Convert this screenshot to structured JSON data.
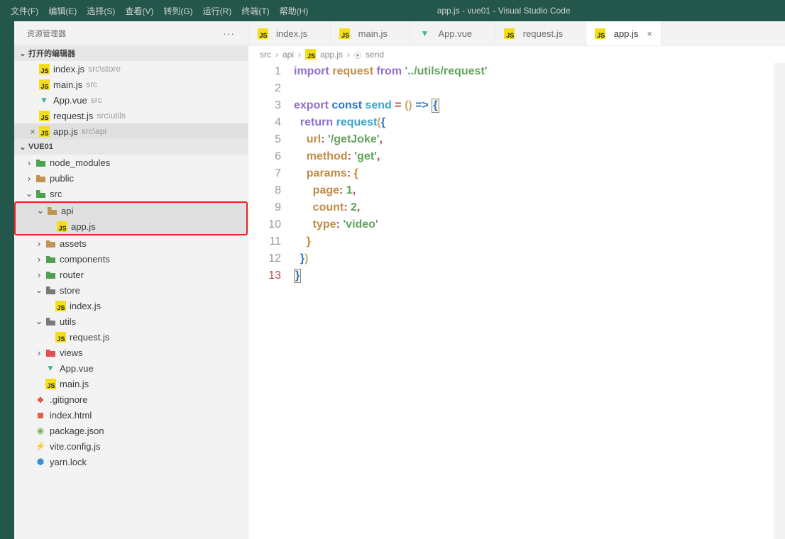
{
  "window_title": "app.js - vue01 - Visual Studio Code",
  "menu": [
    "文件(F)",
    "编辑(E)",
    "选择(S)",
    "查看(V)",
    "转到(G)",
    "运行(R)",
    "终端(T)",
    "帮助(H)"
  ],
  "sidebar": {
    "title": "资源管理器",
    "open_editors_label": "打开的编辑器",
    "project_label": "VUE01",
    "open_editors": [
      {
        "name": "index.js",
        "path": "src\\store",
        "icon": "js"
      },
      {
        "name": "main.js",
        "path": "src",
        "icon": "js"
      },
      {
        "name": "App.vue",
        "path": "src",
        "icon": "vue"
      },
      {
        "name": "request.js",
        "path": "src\\utils",
        "icon": "js"
      },
      {
        "name": "app.js",
        "path": "src\\api",
        "icon": "js",
        "active": true
      }
    ],
    "tree": [
      {
        "level": 0,
        "kind": "folder-closed",
        "color": "green",
        "name": "node_modules"
      },
      {
        "level": 0,
        "kind": "folder-closed",
        "color": "tan",
        "name": "public"
      },
      {
        "level": 0,
        "kind": "folder-open",
        "color": "green",
        "name": "src"
      },
      {
        "level": 1,
        "kind": "folder-open",
        "color": "tan",
        "name": "api",
        "red": true,
        "active": true
      },
      {
        "level": 2,
        "kind": "file",
        "icon": "js",
        "name": "app.js",
        "red": true,
        "active": true
      },
      {
        "level": 1,
        "kind": "folder-closed",
        "color": "tan",
        "name": "assets"
      },
      {
        "level": 1,
        "kind": "folder-closed",
        "color": "green",
        "name": "components"
      },
      {
        "level": 1,
        "kind": "folder-closed",
        "color": "green",
        "name": "router"
      },
      {
        "level": 1,
        "kind": "folder-open",
        "color": "gray",
        "name": "store"
      },
      {
        "level": 2,
        "kind": "file",
        "icon": "js",
        "name": "index.js"
      },
      {
        "level": 1,
        "kind": "folder-open",
        "color": "gray",
        "name": "utils"
      },
      {
        "level": 2,
        "kind": "file",
        "icon": "js",
        "name": "request.js"
      },
      {
        "level": 1,
        "kind": "folder-closed",
        "color": "red",
        "name": "views"
      },
      {
        "level": 1,
        "kind": "file",
        "icon": "vue",
        "name": "App.vue"
      },
      {
        "level": 1,
        "kind": "file",
        "icon": "js",
        "name": "main.js"
      },
      {
        "level": 0,
        "kind": "file",
        "icon": "git",
        "name": ".gitignore"
      },
      {
        "level": 0,
        "kind": "file",
        "icon": "html",
        "name": "index.html"
      },
      {
        "level": 0,
        "kind": "file",
        "icon": "json",
        "name": "package.json"
      },
      {
        "level": 0,
        "kind": "file",
        "icon": "vite",
        "name": "vite.config.js"
      },
      {
        "level": 0,
        "kind": "file",
        "icon": "yarn",
        "name": "yarn.lock"
      }
    ]
  },
  "tabs": [
    {
      "label": "index.js",
      "icon": "js"
    },
    {
      "label": "main.js",
      "icon": "js"
    },
    {
      "label": "App.vue",
      "icon": "vue"
    },
    {
      "label": "request.js",
      "icon": "js"
    },
    {
      "label": "app.js",
      "icon": "js",
      "active": true
    }
  ],
  "breadcrumb": [
    "src",
    "api",
    "app.js",
    "send"
  ],
  "code": {
    "lines": 13,
    "current": 13,
    "tokens": [
      [
        [
          "kw",
          "import"
        ],
        [
          "op",
          " "
        ],
        [
          "nm",
          "request"
        ],
        [
          "op",
          " "
        ],
        [
          "kw",
          "from"
        ],
        [
          "op",
          " "
        ],
        [
          "str",
          "'../utils/request'"
        ]
      ],
      [],
      [
        [
          "kw",
          "export"
        ],
        [
          "op",
          " "
        ],
        [
          "kw2",
          "const"
        ],
        [
          "op",
          " "
        ],
        [
          "fn",
          "send"
        ],
        [
          "op",
          " "
        ],
        [
          "pn",
          "="
        ],
        [
          "op",
          " "
        ],
        [
          "py",
          "()"
        ],
        [
          "op",
          " "
        ],
        [
          "kw2",
          "=>"
        ],
        [
          "op",
          " "
        ],
        [
          "boxchar",
          "{"
        ]
      ],
      [
        [
          "op",
          "  "
        ],
        [
          "kw",
          "return"
        ],
        [
          "op",
          " "
        ],
        [
          "fn",
          "request"
        ],
        [
          "py",
          "("
        ],
        [
          "bl",
          "{"
        ]
      ],
      [
        [
          "op",
          "    "
        ],
        [
          "nm",
          "url"
        ],
        [
          "pn",
          ":"
        ],
        [
          "op",
          " "
        ],
        [
          "str",
          "'/getJoke'"
        ],
        [
          "pn",
          ","
        ]
      ],
      [
        [
          "op",
          "    "
        ],
        [
          "nm",
          "method"
        ],
        [
          "pn",
          ":"
        ],
        [
          "op",
          " "
        ],
        [
          "str",
          "'get'"
        ],
        [
          "pn",
          ","
        ]
      ],
      [
        [
          "op",
          "    "
        ],
        [
          "nm",
          "params"
        ],
        [
          "pn",
          ":"
        ],
        [
          "op",
          " "
        ],
        [
          "par1",
          "{"
        ]
      ],
      [
        [
          "op",
          "      "
        ],
        [
          "nm",
          "page"
        ],
        [
          "pn",
          ":"
        ],
        [
          "op",
          " "
        ],
        [
          "num",
          "1"
        ],
        [
          "pn",
          ","
        ]
      ],
      [
        [
          "op",
          "      "
        ],
        [
          "nm",
          "count"
        ],
        [
          "pn",
          ":"
        ],
        [
          "op",
          " "
        ],
        [
          "num",
          "2"
        ],
        [
          "pn",
          ","
        ]
      ],
      [
        [
          "op",
          "      "
        ],
        [
          "nm",
          "type"
        ],
        [
          "pn",
          ":"
        ],
        [
          "op",
          " "
        ],
        [
          "str",
          "'video'"
        ]
      ],
      [
        [
          "op",
          "    "
        ],
        [
          "par1",
          "}"
        ]
      ],
      [
        [
          "op",
          "  "
        ],
        [
          "bl",
          "}"
        ],
        [
          "py",
          ")"
        ]
      ],
      [
        [
          "boxchar",
          "}"
        ]
      ]
    ]
  }
}
